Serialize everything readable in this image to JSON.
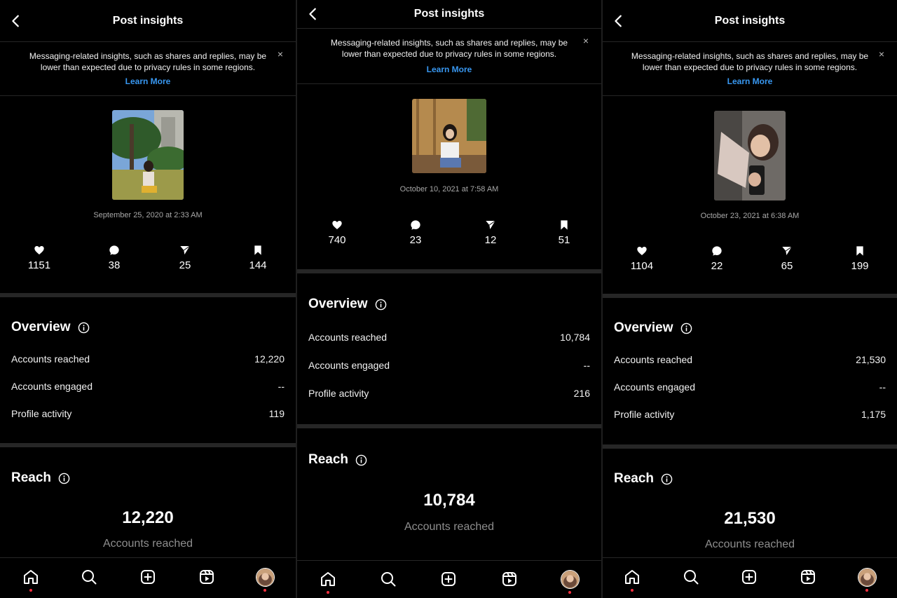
{
  "header": {
    "title": "Post insights",
    "back_icon": "chevron-left-icon"
  },
  "notice": {
    "text": "Messaging-related insights, such as shares and replies, may be lower than expected due to privacy rules in some regions.",
    "link": "Learn More",
    "close": "×"
  },
  "sections": {
    "overview": "Overview",
    "reach": "Reach"
  },
  "row_labels": {
    "reached": "Accounts reached",
    "engaged": "Accounts engaged",
    "profile": "Profile activity"
  },
  "reach_label": "Accounts reached",
  "colors": {
    "link": "#3897f0",
    "notification_dot": "#ff3040",
    "divider": "#262626"
  },
  "tabbar_icons": [
    "home-icon",
    "search-icon",
    "create-icon",
    "reels-icon",
    "profile-avatar"
  ],
  "posts": [
    {
      "date": "September 25, 2020 at 2:33 AM",
      "likes": "1151",
      "comments": "38",
      "shares": "25",
      "saves": "144",
      "accounts_reached": "12,220",
      "accounts_engaged": "--",
      "profile_activity": "119",
      "reach_number": "12,220"
    },
    {
      "date": "October 10, 2021 at 7:58 AM",
      "likes": "740",
      "comments": "23",
      "shares": "12",
      "saves": "51",
      "accounts_reached": "10,784",
      "accounts_engaged": "--",
      "profile_activity": "216",
      "reach_number": "10,784"
    },
    {
      "date": "October 23, 2021 at 6:38 AM",
      "likes": "1104",
      "comments": "22",
      "shares": "65",
      "saves": "199",
      "accounts_reached": "21,530",
      "accounts_engaged": "--",
      "profile_activity": "1,175",
      "reach_number": "21,530"
    }
  ]
}
